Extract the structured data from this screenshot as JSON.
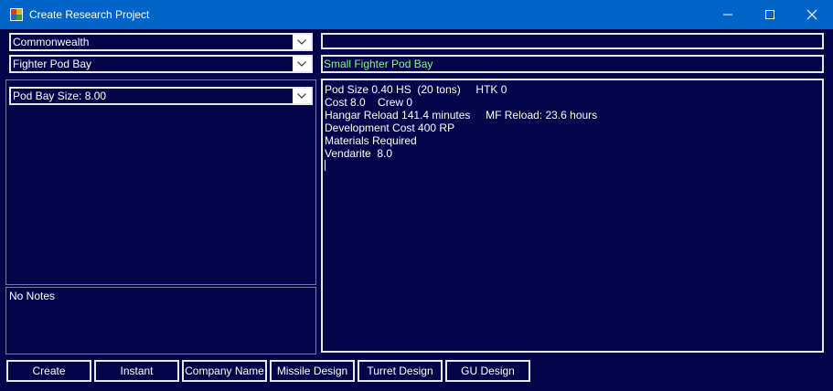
{
  "window": {
    "title": "Create Research Project"
  },
  "left": {
    "race_select": "Commonwealth",
    "component_type_select": "Fighter Pod Bay",
    "size_select": "Pod Bay Size: 8.00",
    "notes": "No Notes"
  },
  "right": {
    "name_field": "",
    "component_name": "Small Fighter Pod Bay",
    "component_name_color": "#7fff7f",
    "details": [
      "Pod Size 0.40 HS  (20 tons)     HTK 0",
      "Cost 8.0    Crew 0",
      "Hangar Reload 141.4 minutes     MF Reload: 23.6 hours",
      "Development Cost 400 RP",
      "",
      "Materials Required",
      "Vendarite  8.0"
    ]
  },
  "buttons": {
    "create": "Create",
    "instant": "Instant",
    "company_name": "Company Name",
    "missile_design": "Missile Design",
    "turret_design": "Turret Design",
    "gu_design": "GU Design"
  },
  "icons": {
    "app": "app-icon",
    "minimize": "minimize-icon",
    "maximize": "maximize-icon",
    "close": "close-icon",
    "dropdown": "chevron-down-icon"
  }
}
